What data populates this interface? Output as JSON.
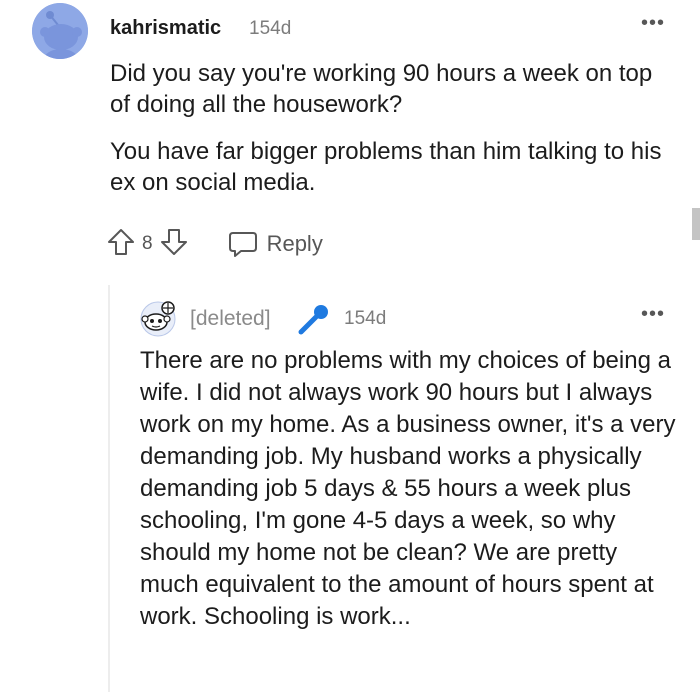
{
  "comment": {
    "username": "kahrismatic",
    "age": "154d",
    "paragraphs": [
      "Did you say you're working 90 hours a week on top of doing all the housework?",
      "You have far bigger problems than him talking to his ex on social media."
    ],
    "vote_count": "8",
    "reply_label": "Reply",
    "more_label": "•••",
    "icons": [
      "avatar-icon",
      "upvote-icon",
      "downvote-icon",
      "reply-icon",
      "more-icon"
    ]
  },
  "reply": {
    "username": "[deleted]",
    "age": "154d",
    "more_label": "•••",
    "body": "There are no problems with my choices of being a wife. I did not always work 90 hours but I always work on my home. As a business owner, it's a very demanding job. My husband works a physically demanding job 5 days & 55 hours a week plus schooling, I'm gone 4-5 days a week, so why should my home not be clean? We are pretty much equivalent to the amount of hours spent at work. Schooling is work...",
    "icons": [
      "avatar-icon",
      "microphone-icon",
      "more-icon"
    ]
  },
  "colors": {
    "avatar_bg": "#8ea8e6",
    "mic_blue": "#1f7ae0",
    "text": "#1c1c1c",
    "muted": "#7c7c7c"
  }
}
